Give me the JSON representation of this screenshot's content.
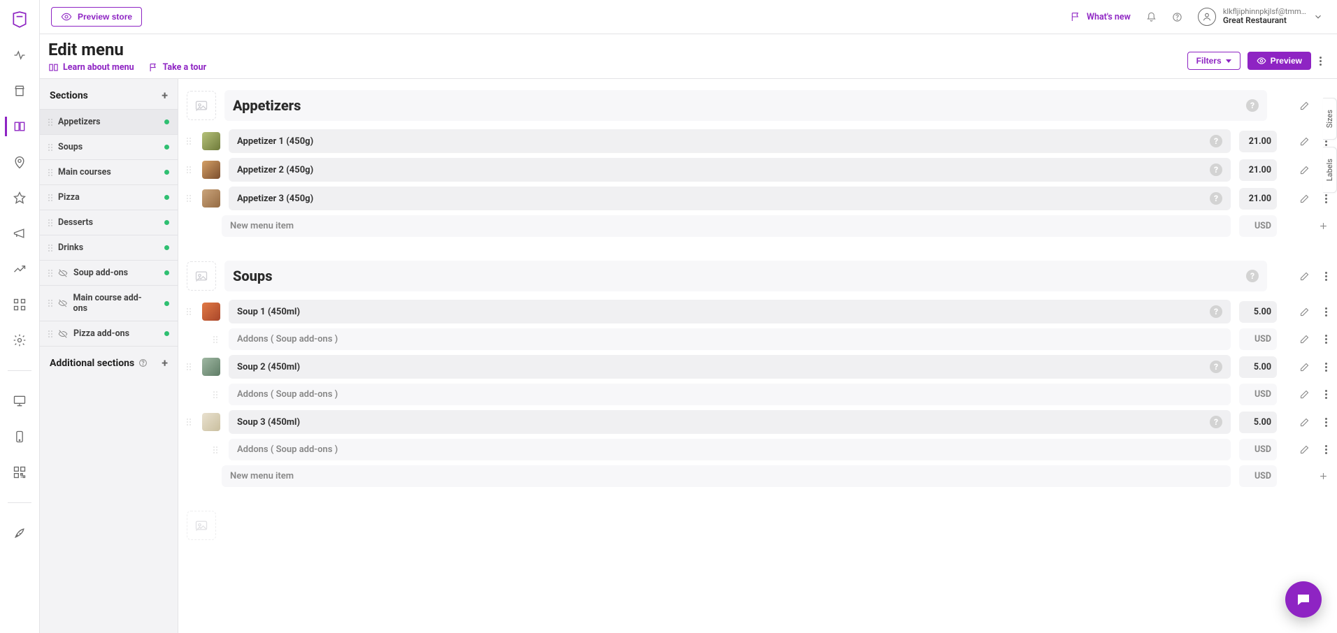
{
  "topbar": {
    "preview_store": "Preview store",
    "whats_new": "What's new",
    "user_email": "klkfljiphinnpkjlsf@tmm…",
    "restaurant": "Great Restaurant"
  },
  "page": {
    "title": "Edit menu",
    "learn": "Learn about menu",
    "tour": "Take a tour",
    "filters": "Filters",
    "preview": "Preview"
  },
  "sections_panel": {
    "title": "Sections",
    "additional_title": "Additional sections",
    "items": [
      {
        "label": "Appetizers",
        "hidden": false
      },
      {
        "label": "Soups",
        "hidden": false
      },
      {
        "label": "Main courses",
        "hidden": false
      },
      {
        "label": "Pizza",
        "hidden": false
      },
      {
        "label": "Desserts",
        "hidden": false
      },
      {
        "label": "Drinks",
        "hidden": false
      },
      {
        "label": "Soup add-ons",
        "hidden": true
      },
      {
        "label": "Main course add-ons",
        "hidden": true
      },
      {
        "label": "Pizza add-ons",
        "hidden": true
      }
    ]
  },
  "currency": "USD",
  "new_item_placeholder": "New menu item",
  "sections": [
    {
      "title": "Appetizers",
      "items": [
        {
          "name": "Appetizer 1 (450g)",
          "price": "21.00",
          "thumb": "t1"
        },
        {
          "name": "Appetizer 2 (450g)",
          "price": "21.00",
          "thumb": "t2"
        },
        {
          "name": "Appetizer 3 (450g)",
          "price": "21.00",
          "thumb": "t3"
        }
      ]
    },
    {
      "title": "Soups",
      "items": [
        {
          "name": "Soup 1 (450ml)",
          "price": "5.00",
          "thumb": "t4",
          "addon": "Addons ( Soup add-ons )"
        },
        {
          "name": "Soup 2 (450ml)",
          "price": "5.00",
          "thumb": "t5",
          "addon": "Addons ( Soup add-ons )"
        },
        {
          "name": "Soup 3 (450ml)",
          "price": "5.00",
          "thumb": "t6",
          "addon": "Addons ( Soup add-ons )"
        }
      ]
    }
  ],
  "side_tabs": {
    "sizes": "Sizes",
    "labels": "Labels"
  }
}
